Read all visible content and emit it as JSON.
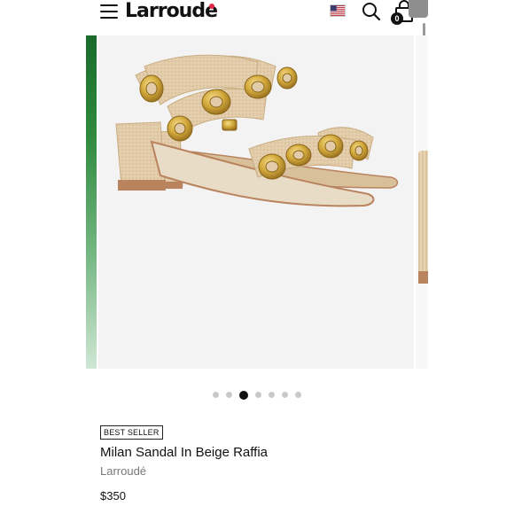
{
  "header": {
    "logo_text": "Larroude",
    "cart_count": "0",
    "icons": [
      "menu-icon",
      "us-flag-icon",
      "search-icon",
      "shopping-bag-icon"
    ]
  },
  "gallery": {
    "image_alt": "Milan Sandal In Beige Raffia",
    "slide_count": 7,
    "active_slide": 3
  },
  "product": {
    "badge": "BEST SELLER",
    "title": "Milan Sandal In Beige Raffia",
    "brand": "Larroudé",
    "price": "$350"
  },
  "colors": {
    "logo_dot": "#e3264a",
    "raffia": "#dcc39f",
    "gold_hardware": "#caa033",
    "sole": "#b9835e",
    "active_dot": "#111111",
    "inactive_dot": "#c9c9c9"
  }
}
